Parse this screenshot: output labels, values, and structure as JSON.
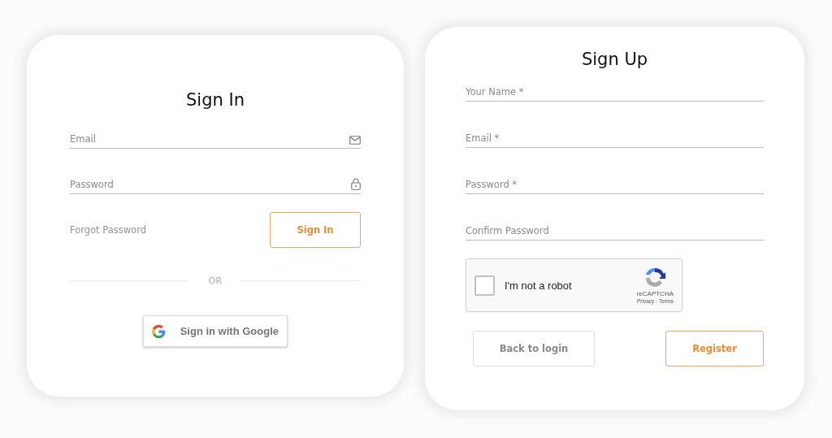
{
  "sign_in": {
    "title": "Sign In",
    "fields": [
      {
        "placeholder": "Email",
        "kind": "email"
      },
      {
        "placeholder": "Password",
        "kind": "password"
      }
    ],
    "forgot_link": "Forgot Password",
    "submit_button": "Sign In",
    "divider": "OR",
    "google_button": "Sign in with Google"
  },
  "sign_up": {
    "title": "Sign Up",
    "fields": [
      {
        "placeholder": "Your Name *"
      },
      {
        "placeholder": "Email *"
      },
      {
        "placeholder": "Password *"
      },
      {
        "placeholder": "Confirm Password"
      }
    ],
    "captcha": {
      "label": "I'm not a robot",
      "checked": false,
      "brand": "reCAPTCHA",
      "links": "Privacy - Terms"
    },
    "back_button": "Back to login",
    "register_button": "Register"
  }
}
